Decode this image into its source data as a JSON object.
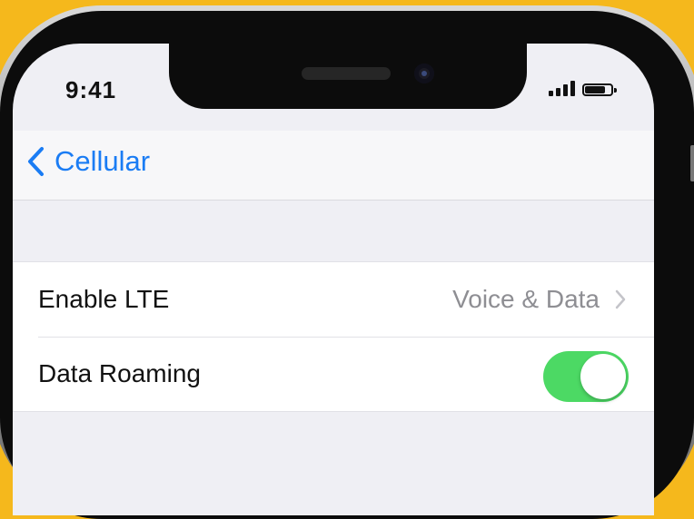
{
  "status_bar": {
    "time": "9:41",
    "signal_icon": "cellular-signal-icon",
    "battery_icon": "battery-icon",
    "battery_level": 0.85
  },
  "navbar": {
    "back_label": "Cellular",
    "back_icon": "chevron-left-icon"
  },
  "settings": {
    "rows": [
      {
        "label": "Enable LTE",
        "value": "Voice & Data",
        "icon": "chevron-right-icon"
      },
      {
        "label": "Data Roaming",
        "toggle_on": true
      }
    ]
  },
  "colors": {
    "accent_blue": "#1a7cf4",
    "toggle_green": "#4cd964",
    "background_yellow": "#f5b81c"
  }
}
